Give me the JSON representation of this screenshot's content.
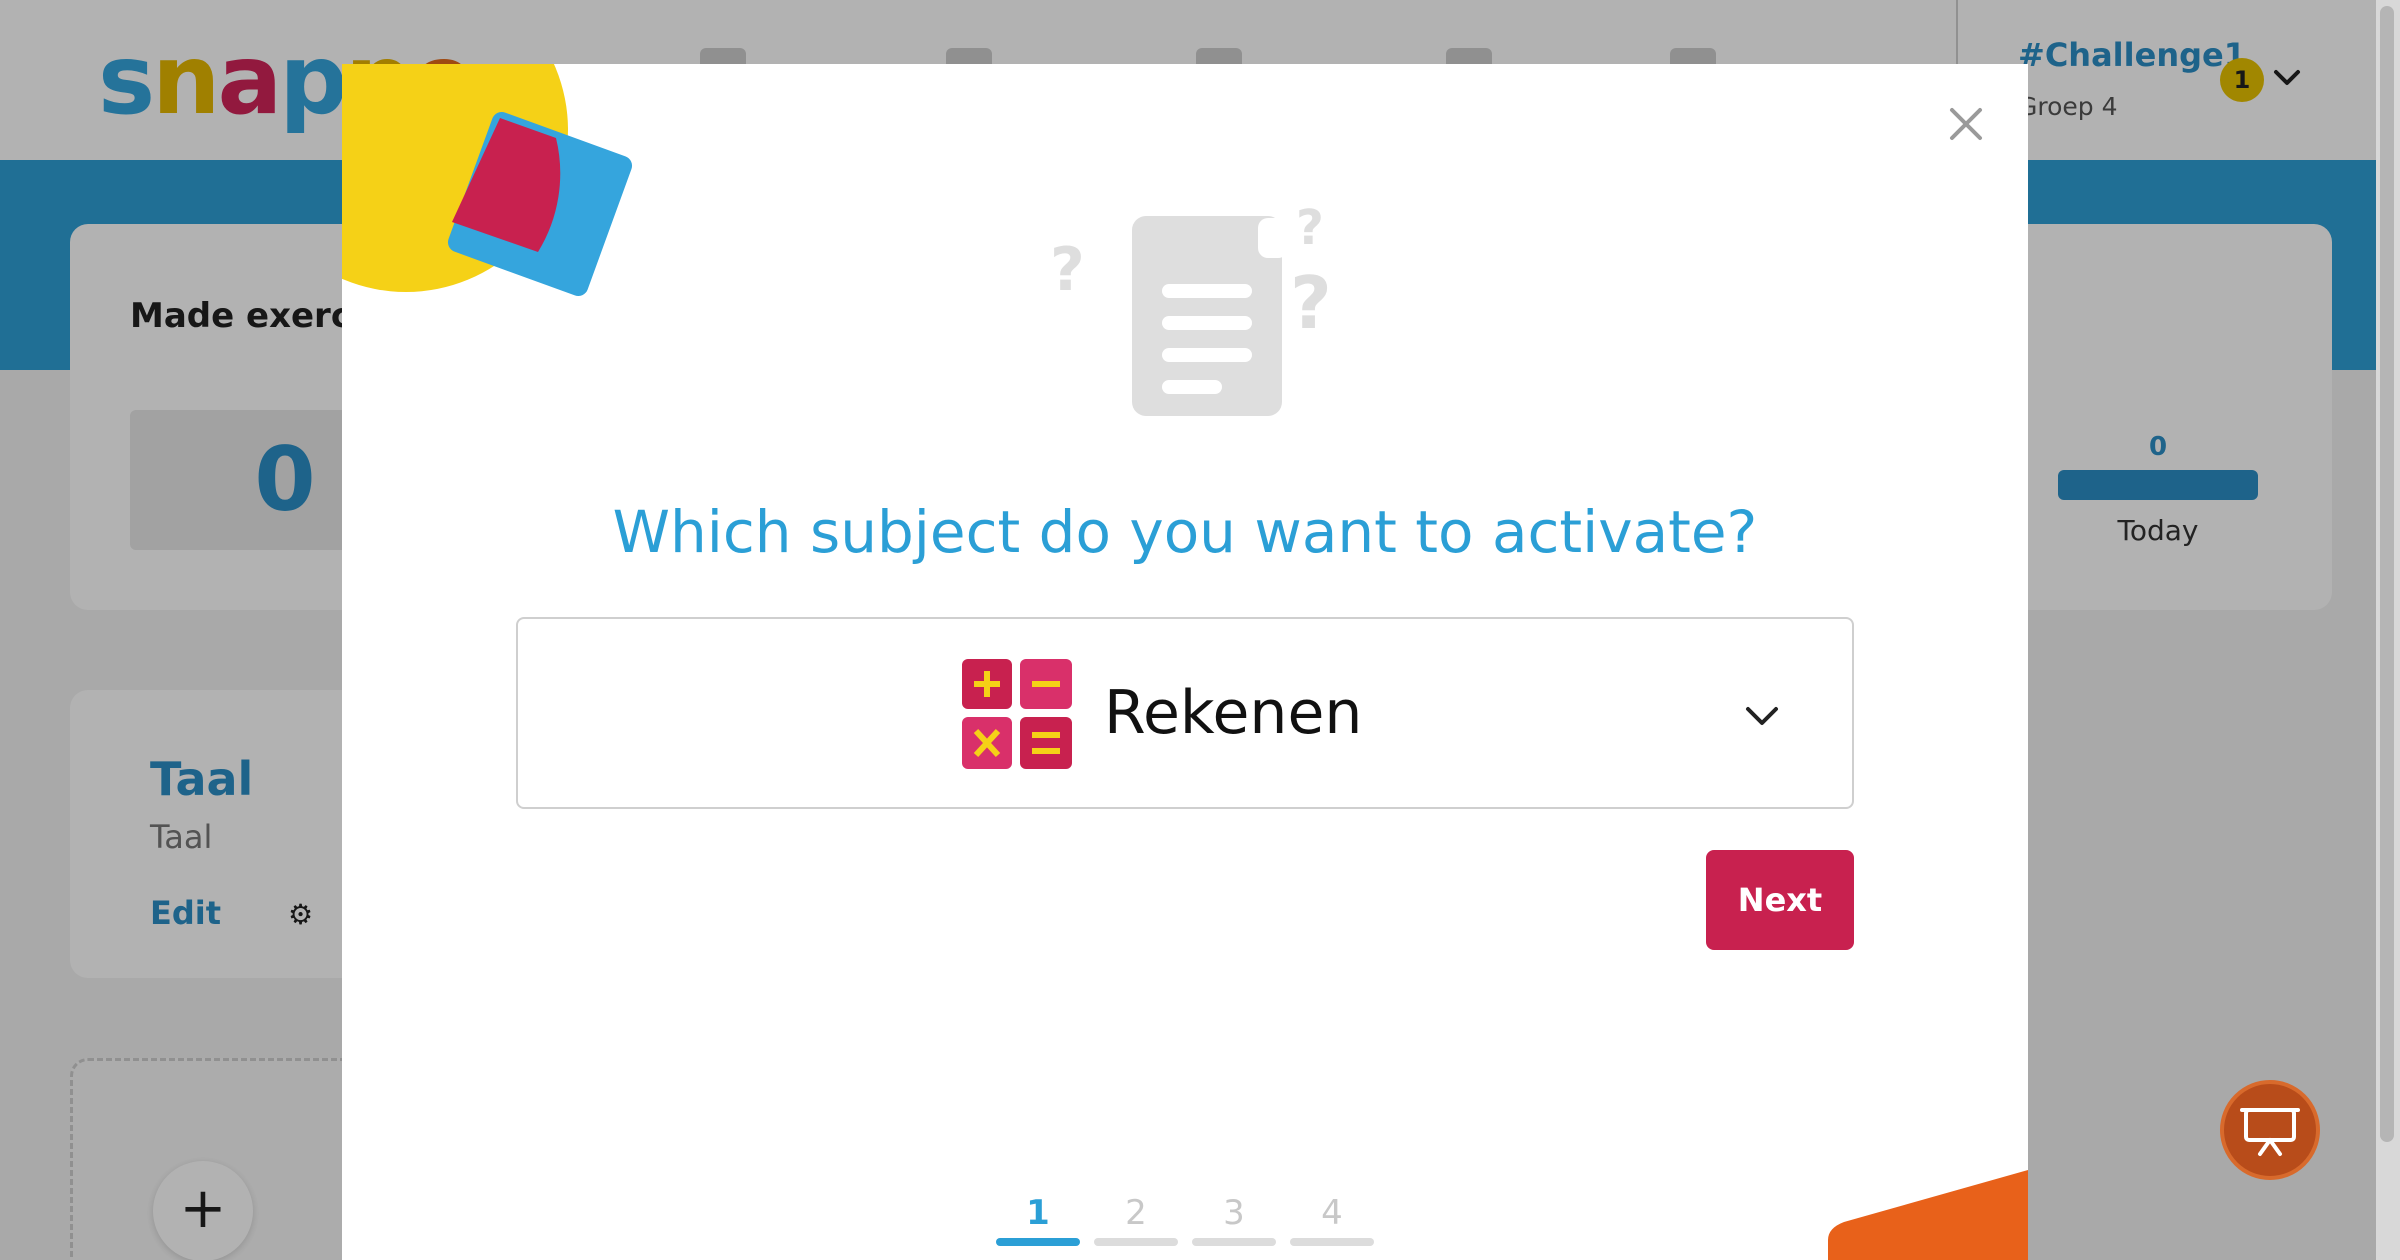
{
  "app": {
    "logo_letters": [
      "s",
      "n",
      "a",
      "p",
      "p",
      "e"
    ],
    "user": {
      "name": "#Challenge1",
      "group": "Groep 4",
      "notification_count": "1"
    },
    "stats": {
      "title": "Made exercis",
      "value": "0",
      "today_value": "0",
      "today_label": "Today"
    },
    "subject_card": {
      "title": "Taal",
      "subtitle": "Taal",
      "edit_label": "Edit"
    },
    "add_label": "+"
  },
  "modal": {
    "close_icon": "close-icon",
    "question": "Which subject do you want to activate?",
    "select": {
      "value": "Rekenen",
      "icon": "math-operators-icon"
    },
    "next_label": "Next",
    "steps": [
      "1",
      "2",
      "3",
      "4"
    ],
    "active_step": "1"
  },
  "colors": {
    "brand_blue": "#2b9fd6",
    "next_button": "#c8214f",
    "deco_yellow": "#f5d117",
    "deco_red": "#c8214f",
    "deco_orange": "#e8611a"
  }
}
